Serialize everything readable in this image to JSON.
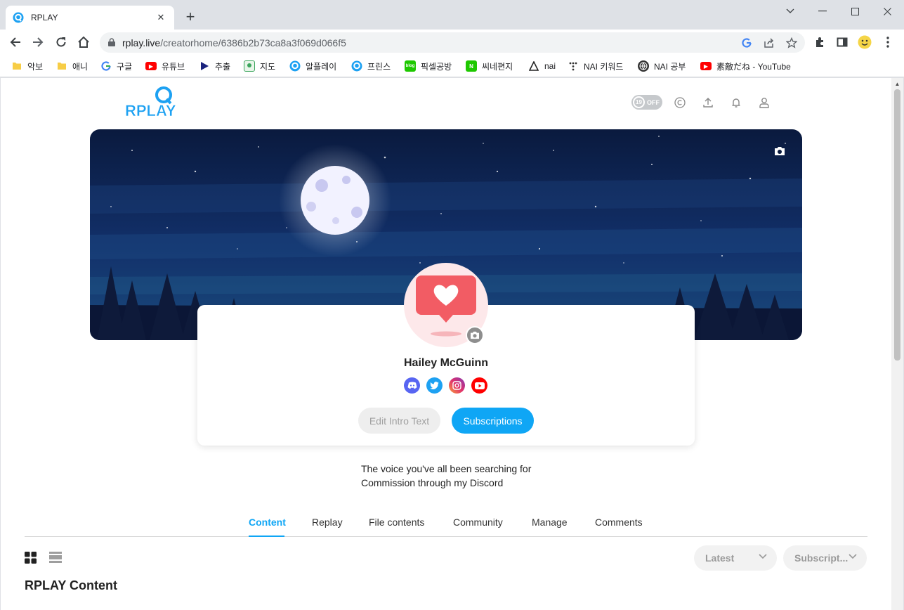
{
  "browser": {
    "tab_title": "RPLAY",
    "url_host": "rplay.live",
    "url_path": "/creatorhome/6386b2b73ca8a3f069d066f5",
    "bookmarks": [
      {
        "label": "악보",
        "icon": "folder-icon"
      },
      {
        "label": "애니",
        "icon": "folder-icon"
      },
      {
        "label": "구글",
        "icon": "google-icon"
      },
      {
        "label": "유튜브",
        "icon": "youtube-icon"
      },
      {
        "label": "추출",
        "icon": "play-icon"
      },
      {
        "label": "지도",
        "icon": "map-icon"
      },
      {
        "label": "알플레이",
        "icon": "rplay-icon"
      },
      {
        "label": "프린스",
        "icon": "rplay-icon"
      },
      {
        "label": "픽셀공방",
        "icon": "blog-icon"
      },
      {
        "label": "씨네편지",
        "icon": "naver-icon"
      },
      {
        "label": "nai",
        "icon": "nai-icon"
      },
      {
        "label": "NAI 키워드",
        "icon": "dots-icon"
      },
      {
        "label": "NAI 공부",
        "icon": "globe-icon"
      },
      {
        "label": "素敵だね - YouTube",
        "icon": "youtube-icon"
      }
    ]
  },
  "header": {
    "logo_text": "RPLAY",
    "adult_badge_number": "19",
    "adult_badge_state": "OFF"
  },
  "profile": {
    "name": "Hailey McGuinn",
    "edit_button": "Edit Intro Text",
    "subscribe_button": "Subscriptions",
    "socials": [
      "discord-icon",
      "twitter-icon",
      "instagram-icon",
      "youtube-icon"
    ],
    "intro_lines": [
      "The voice you've all been searching for",
      "Commission through my Discord"
    ]
  },
  "content_tabs": [
    "Content",
    "Replay",
    "File contents",
    "Community",
    "Manage",
    "Comments"
  ],
  "active_tab": "Content",
  "filters": {
    "sort": "Latest",
    "subscription": "Subscript..."
  },
  "section_title": "RPLAY Content",
  "colors": {
    "accent": "#0fa6f5",
    "banner_sky": "#0e2350",
    "avatar_bg": "#fde8ea",
    "heart_bubble": "#f25c64"
  }
}
